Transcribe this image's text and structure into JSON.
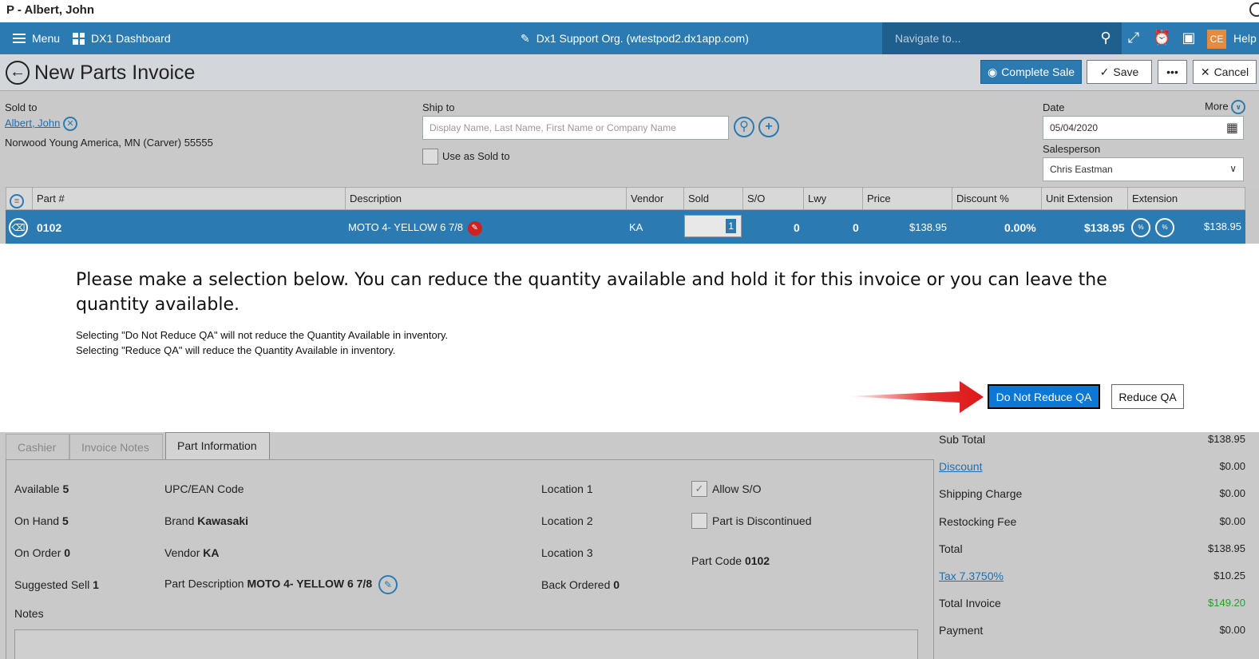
{
  "window": {
    "title": "P - Albert, John"
  },
  "nav": {
    "menu": "Menu",
    "dashboard": "DX1 Dashboard",
    "org": "Dx1 Support Org. (wtestpod2.dx1app.com)",
    "search_placeholder": "Navigate to...",
    "avatar": "CE",
    "help": "Help"
  },
  "header": {
    "title": "New Parts Invoice",
    "complete_sale": "Complete Sale",
    "save": "Save",
    "more": "•••",
    "cancel": "Cancel"
  },
  "form": {
    "sold_to_label": "Sold to",
    "sold_to_name": "Albert, John",
    "sold_to_address": "Norwood Young America, MN (Carver) 55555",
    "ship_to_label": "Ship to",
    "ship_to_placeholder": "Display Name, Last Name, First Name or Company Name",
    "use_as_sold_to": "Use as Sold to",
    "date_label": "Date",
    "more_label": "More",
    "date_value": "05/04/2020",
    "salesperson_label": "Salesperson",
    "salesperson_value": "Chris Eastman"
  },
  "table": {
    "headers": [
      "Part #",
      "Description",
      "Vendor",
      "Sold",
      "S/O",
      "Lwy",
      "Price",
      "Discount %",
      "Unit Extension",
      "Extension"
    ],
    "row": {
      "part": "0102",
      "description": "MOTO 4- YELLOW 6 7/8",
      "vendor": "KA",
      "sold": "1",
      "so": "0",
      "lwy": "0",
      "price": "$138.95",
      "discount": "0.00%",
      "unit_extension": "$138.95",
      "extension": "$138.95"
    }
  },
  "dialog": {
    "title": "Please make a selection below. You can reduce the quantity available and hold it for this invoice or you can leave the quantity available.",
    "line1": "Selecting \"Do Not Reduce QA\" will not reduce the Quantity Available in inventory.",
    "line2": "Selecting \"Reduce QA\" will reduce the Quantity Available in inventory.",
    "do_not_reduce": "Do Not Reduce QA",
    "reduce": "Reduce QA"
  },
  "tabs": [
    "Cashier",
    "Invoice Notes",
    "Part Information"
  ],
  "part_info": {
    "available_label": "Available",
    "available": "5",
    "on_hand_label": "On Hand",
    "on_hand": "5",
    "on_order_label": "On Order",
    "on_order": "0",
    "suggested_sell_label": "Suggested Sell",
    "suggested_sell": "1",
    "upc_label": "UPC/EAN Code",
    "brand_label": "Brand",
    "brand": "Kawasaki",
    "vendor_label": "Vendor",
    "vendor": "KA",
    "part_desc_label": "Part Description",
    "part_desc": "MOTO 4- YELLOW 6 7/8",
    "location1": "Location 1",
    "location2": "Location 2",
    "location3": "Location 3",
    "back_ordered_label": "Back Ordered",
    "back_ordered": "0",
    "allow_so": "Allow S/O",
    "discontinued": "Part is Discontinued",
    "part_code_label": "Part Code",
    "part_code": "0102",
    "notes_label": "Notes"
  },
  "totals": [
    {
      "label": "Sub Total",
      "value": "$138.95",
      "link": false
    },
    {
      "label": "Discount",
      "value": "$0.00",
      "link": true
    },
    {
      "label": "Shipping Charge",
      "value": "$0.00",
      "link": false
    },
    {
      "label": "Restocking Fee",
      "value": "$0.00",
      "link": false
    },
    {
      "label": "Total",
      "value": "$138.95",
      "link": false
    },
    {
      "label": "Tax 7.3750%",
      "value": "$10.25",
      "link": true
    },
    {
      "label": "Total Invoice",
      "value": "$149.20",
      "link": false
    },
    {
      "label": "Payment",
      "value": "$0.00",
      "link": false
    }
  ],
  "colors": {
    "nav": "#2b7bb2",
    "primary_button": "#0a78d4",
    "arrow": "#e01818",
    "total_invoice": "#2a9a2a"
  }
}
